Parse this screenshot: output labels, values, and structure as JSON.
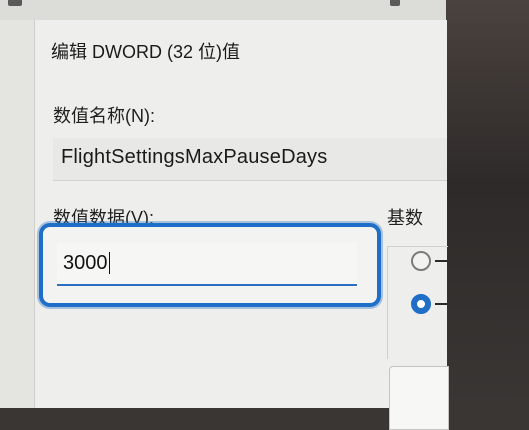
{
  "dialog": {
    "title": "编辑 DWORD (32 位)值",
    "value_name_label": "数值名称(N):",
    "value_name": "FlightSettingsMaxPauseDays",
    "value_data_label": "数值数据(V):",
    "value_data": "3000",
    "base_label": "基数",
    "base_options": [
      {
        "selected": false
      },
      {
        "selected": true
      }
    ]
  },
  "colors": {
    "accent": "#1f6fc8",
    "dialog_bg": "#eeeeec",
    "text": "#1b1b1b"
  }
}
